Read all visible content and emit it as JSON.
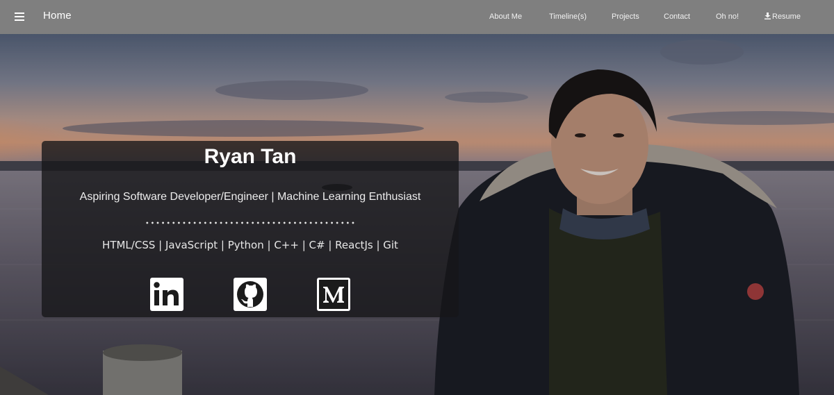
{
  "nav": {
    "brand": "Home",
    "links": [
      {
        "label": "About Me"
      },
      {
        "label": "Timeline(s)"
      },
      {
        "label": "Projects"
      },
      {
        "label": "Contact"
      },
      {
        "label": "Oh no!"
      },
      {
        "label": "Resume"
      }
    ],
    "icons": {
      "menu": "hamburger-icon",
      "resume": "download-icon"
    }
  },
  "hero": {
    "name": "Ryan Tan",
    "tagline": "Aspiring Software Developer/Engineer | Machine Learning Enthusiast",
    "skills": "HTML/CSS | JavaScript | Python | C++ | C# | ReactJs | Git",
    "socials": [
      {
        "icon": "linkedin-icon"
      },
      {
        "icon": "github-icon"
      },
      {
        "icon": "medium-icon"
      }
    ]
  },
  "colors": {
    "navbar": "#7f7f7f",
    "card": "#161618",
    "text": "#ffffff"
  }
}
